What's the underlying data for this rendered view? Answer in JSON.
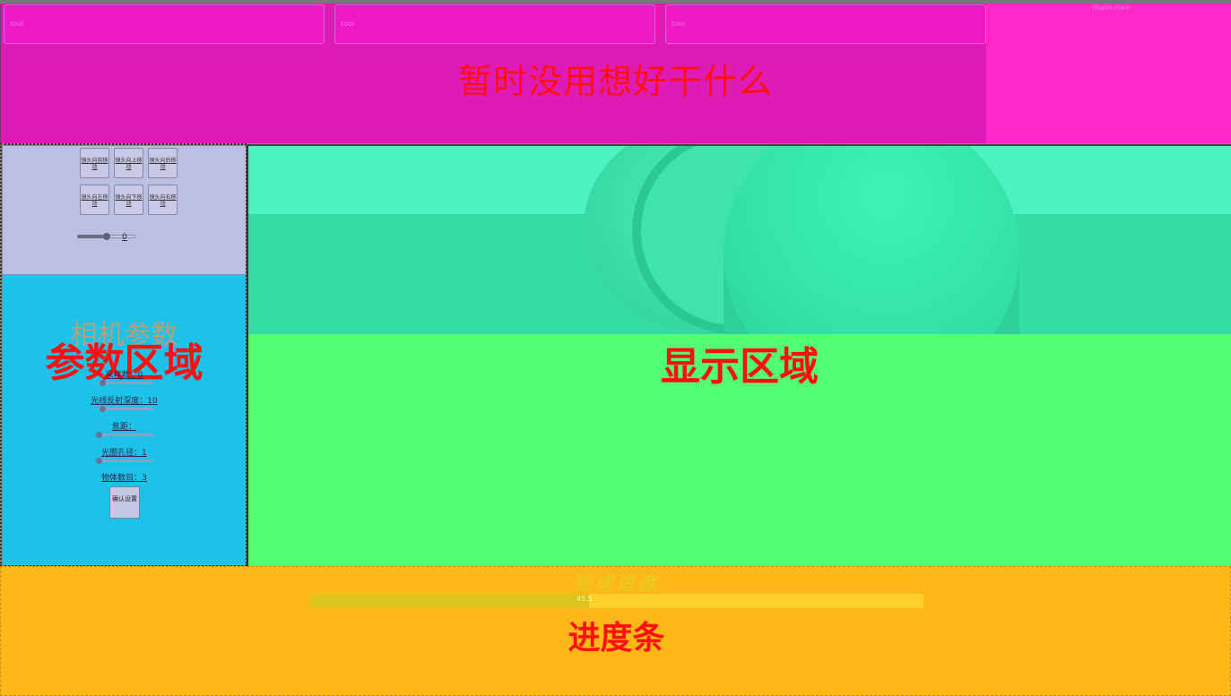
{
  "header": {
    "title": "暂时没用想好干什么",
    "nav_label": "main-nav",
    "boxes": [
      "tool",
      "tool",
      "tool"
    ]
  },
  "controls": {
    "buttons_row1": [
      "镜头向前移动",
      "镜头向上移动",
      "镜头向后移动"
    ],
    "buttons_row2": [
      "镜头向左移动",
      "镜头向下移动",
      "镜头向右移动"
    ],
    "zoom_value": "0"
  },
  "params": {
    "ghost_title": "相机参数",
    "title": "参数区域",
    "rows": [
      {
        "label": "采样数：0",
        "level": 0.05
      },
      {
        "label": "光线反射深度：10",
        "level": 0.05
      },
      {
        "label": "焦距：",
        "level": 0
      },
      {
        "label": "光圈孔径：1",
        "level": 0
      },
      {
        "label": "物体数目：3"
      }
    ],
    "confirm_label": "确认设置"
  },
  "display": {
    "title": "显示区域"
  },
  "footer": {
    "ghost_title": "完成进度",
    "progress_text": "45.5",
    "progress": 0.455,
    "title": "进度条"
  }
}
